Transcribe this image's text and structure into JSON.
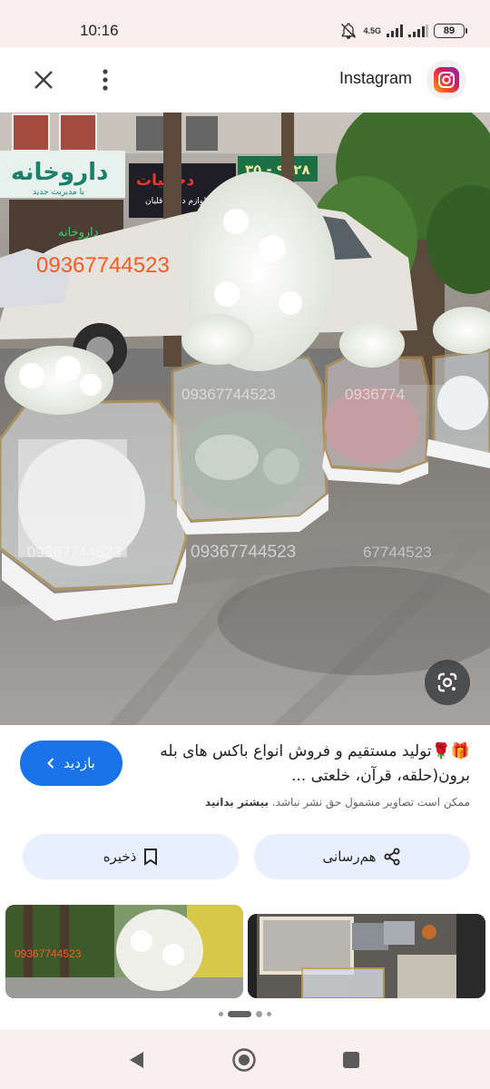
{
  "status_bar": {
    "time": "10:16",
    "network": "4.5G",
    "battery": "89"
  },
  "top_bar": {
    "site_name": "Instagram",
    "icons": [
      "close-icon",
      "more-vert-icon",
      "instagram-logo"
    ]
  },
  "photo": {
    "watermark_phone": "09367744523",
    "shop_sign_1": "داروخانه",
    "shop_sign_1_sub": "با مدیریت جدید",
    "shop_sign_2": "دخانیات",
    "shop_sign_2_sub": "لوازم دخانی قلیان",
    "shop_sign_3": "۳۵ - ۹۲۲۸",
    "lens_icon": "google-lens-icon"
  },
  "result": {
    "visit_label": "بازدید",
    "title": "🎁🌹تولید مستقیم و فروش انواع باکس های بله برون(حلقه، قرآن، خلعتی ...",
    "copyright_text": "ممکن است تصاویر مشمول حق نشر نباشد.",
    "learn_more": "بیشتر بدانید"
  },
  "actions": {
    "share_label": "هم‌رسانی",
    "save_label": "ذخیره"
  },
  "thumbnails": {
    "watermark": "09367744523",
    "count_dots": 4
  },
  "colors": {
    "accent": "#1a73e8",
    "pill_bg": "#e8f0fe",
    "system_bar": "#fbeeee"
  }
}
